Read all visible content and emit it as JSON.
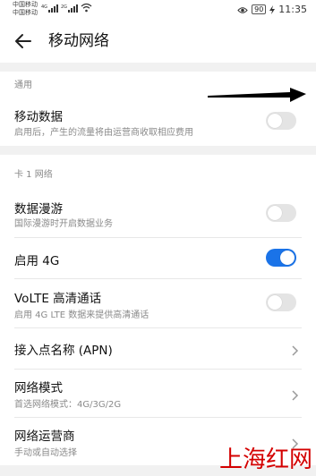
{
  "status_bar": {
    "carrier_1": "中国移动",
    "carrier_2": "中国移动",
    "net_type_1": "4G",
    "net_type_2": "2G",
    "battery": "90",
    "time": "11:35"
  },
  "header": {
    "title": "移动网络"
  },
  "sections": {
    "general": "通用",
    "card1": "卡 1 网络"
  },
  "rows": {
    "mobile_data": {
      "label": "移动数据",
      "sub": "启用后，产生的流量将由运营商收取相应费用",
      "on": false
    },
    "roaming": {
      "label": "数据漫游",
      "sub": "国际漫游时开启数据业务",
      "on": false
    },
    "enable_4g": {
      "label": "启用 4G",
      "on": true
    },
    "volte": {
      "label": "VoLTE 高清通话",
      "sub": "启用 4G LTE 数据来提供高清通话",
      "on": false
    },
    "apn": {
      "label": "接入点名称 (APN)"
    },
    "network_mode": {
      "label": "网络模式",
      "sub": "首选网络模式：4G/3G/2G"
    },
    "operator": {
      "label": "网络运营商",
      "sub": "手动或自动选择"
    }
  },
  "watermark": "上海红网",
  "colors": {
    "accent": "#1a73e8",
    "watermark": "#d40000"
  }
}
